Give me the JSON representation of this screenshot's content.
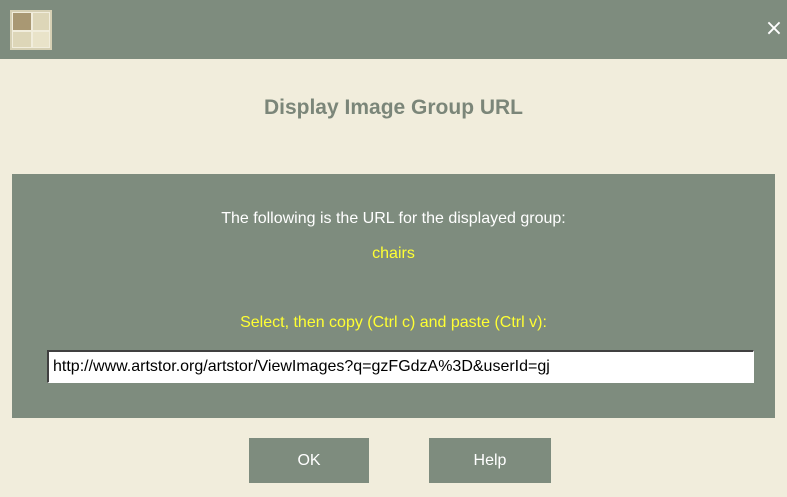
{
  "window": {
    "close_glyph": "×"
  },
  "dialog": {
    "title": "Display Image Group URL",
    "intro_text": "The following is the URL for the displayed group:",
    "group_name": "chairs",
    "instructions": "Select, then copy (Ctrl c) and paste (Ctrl v):",
    "url_value": "http://www.artstor.org/artstor/ViewImages?q=gzFGdzA%3D&userId=gj"
  },
  "buttons": {
    "ok_label": "OK",
    "help_label": "Help"
  },
  "colors": {
    "panel": "#7e8c7e",
    "background": "#f1eddc",
    "heading": "#7b8679",
    "highlight_text": "#ffff33",
    "light_text": "#ffffff"
  },
  "icons": {
    "app": "app-window-icon",
    "close": "close-icon"
  }
}
